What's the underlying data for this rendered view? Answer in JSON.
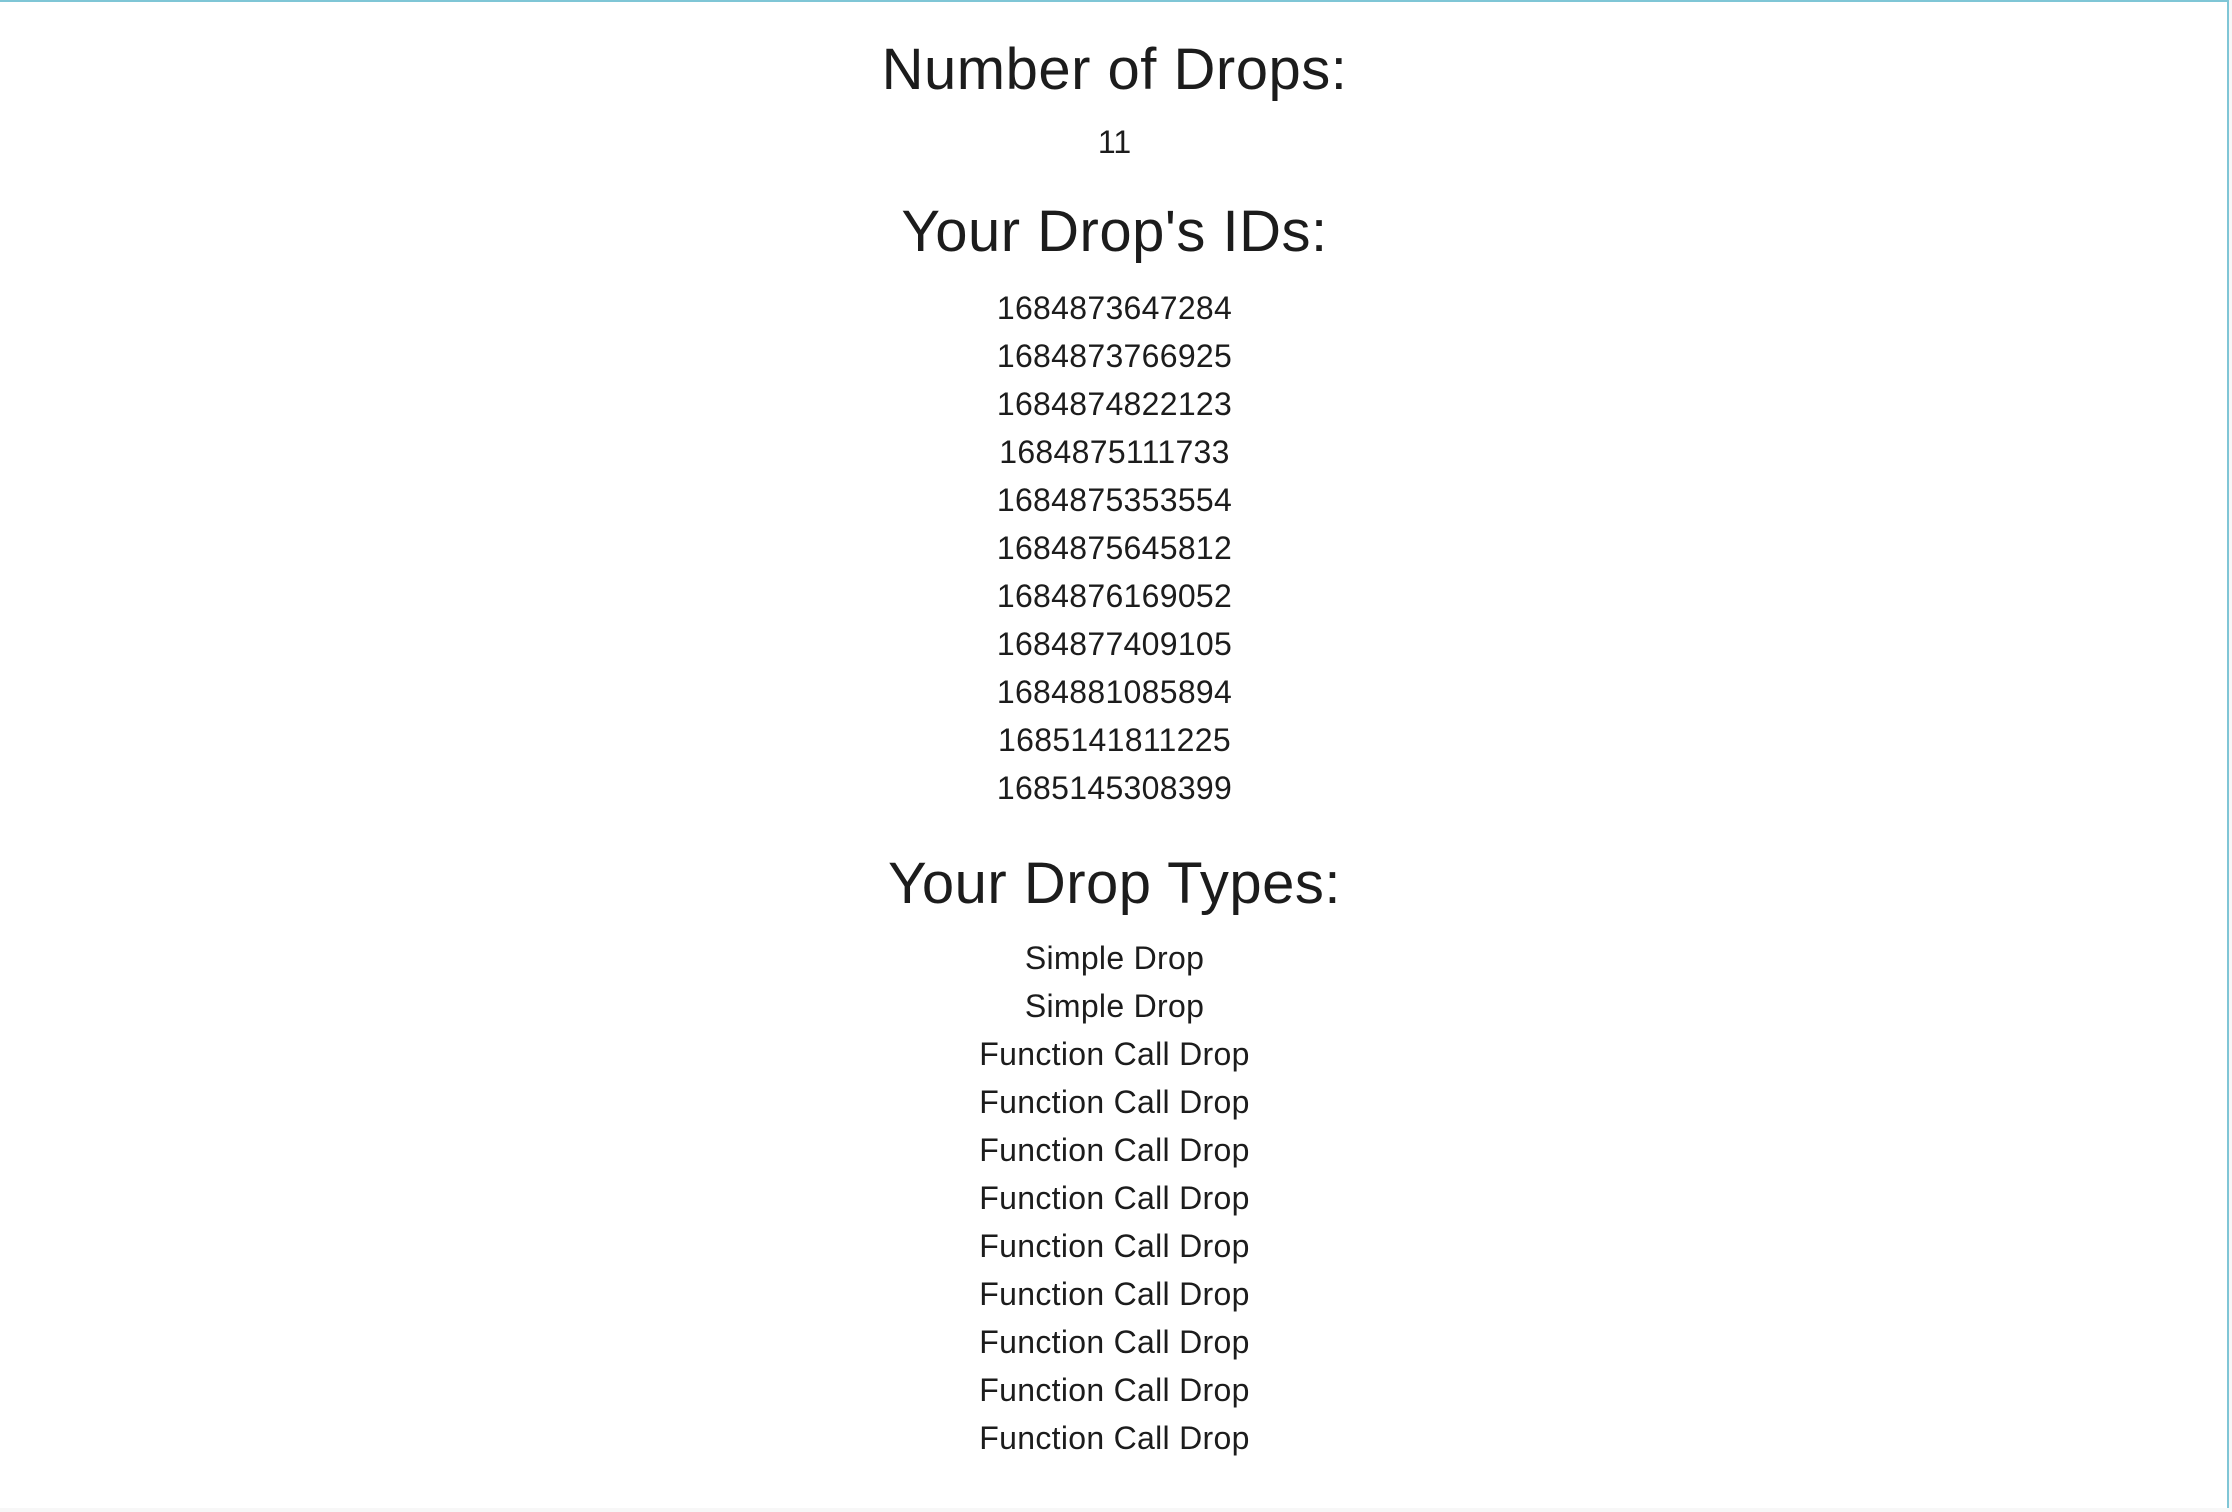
{
  "drops": {
    "count_heading": "Number of Drops:",
    "count": "11",
    "ids_heading": "Your Drop's IDs:",
    "ids": [
      "1684873647284",
      "1684873766925",
      "1684874822123",
      "1684875111733",
      "1684875353554",
      "1684875645812",
      "1684876169052",
      "1684877409105",
      "1684881085894",
      "1685141811225",
      "1685145308399"
    ],
    "types_heading": "Your Drop Types:",
    "types": [
      "Simple Drop",
      "Simple Drop",
      "Function Call Drop",
      "Function Call Drop",
      "Function Call Drop",
      "Function Call Drop",
      "Function Call Drop",
      "Function Call Drop",
      "Function Call Drop",
      "Function Call Drop",
      "Function Call Drop"
    ]
  }
}
